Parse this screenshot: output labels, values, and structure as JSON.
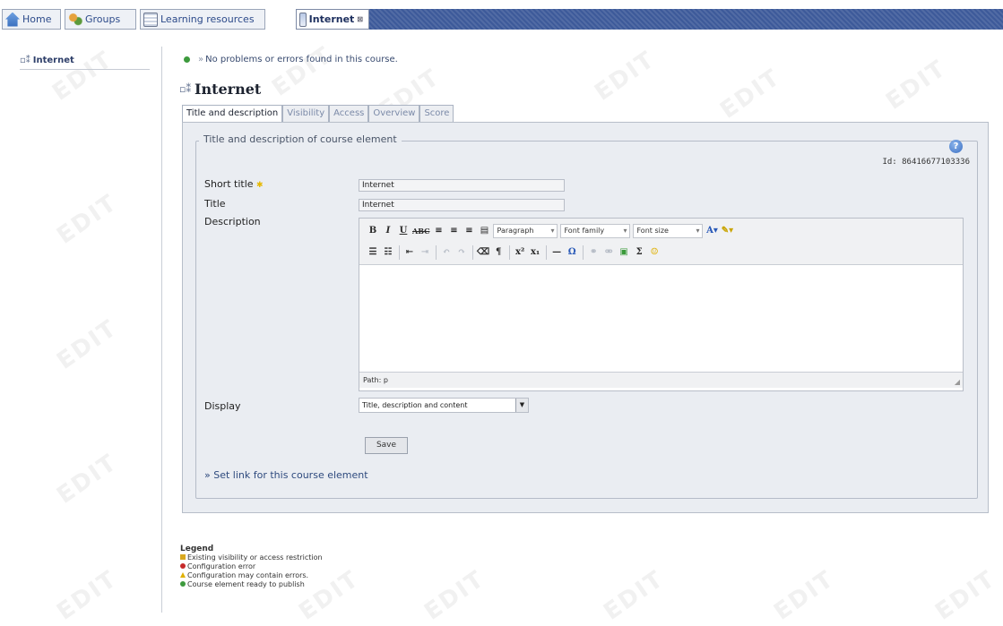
{
  "tabs": [
    {
      "label": "Home",
      "icon": "home-icon"
    },
    {
      "label": "Groups",
      "icon": "groups-icon"
    },
    {
      "label": "Learning resources",
      "icon": "learning-resources-icon"
    },
    {
      "label": "Internet",
      "icon": "internet-icon",
      "active": true
    }
  ],
  "sidebar": {
    "item_label": "Internet"
  },
  "status": {
    "message": "No problems or errors found in this course."
  },
  "page": {
    "title": "Internet"
  },
  "element_tabs": [
    "Title and description",
    "Visibility",
    "Access",
    "Overview",
    "Score"
  ],
  "form": {
    "legend": "Title and description of course element",
    "id_label": "Id: 86416677103336",
    "short_title_label": "Short title",
    "short_title_value": "Internet",
    "title_label": "Title",
    "title_value": "Internet",
    "description_label": "Description",
    "display_label": "Display",
    "display_value": "Title, description and content",
    "save_label": "Save",
    "set_link_label": "Set link for this course element"
  },
  "editor": {
    "format_select": "Paragraph",
    "font_family_select": "Font family",
    "font_size_select": "Font size",
    "path_label": "Path: p",
    "content": ""
  },
  "legend": {
    "heading": "Legend",
    "items": [
      "Existing visibility or access restriction",
      "Configuration error",
      "Configuration may contain errors.",
      "Course element ready to publish"
    ]
  },
  "watermark": "EDIT",
  "colors": {
    "nav_stripe": "#3d5a9a",
    "panel_bg": "#eaedf2",
    "ok_green": "#3d9a3d"
  }
}
